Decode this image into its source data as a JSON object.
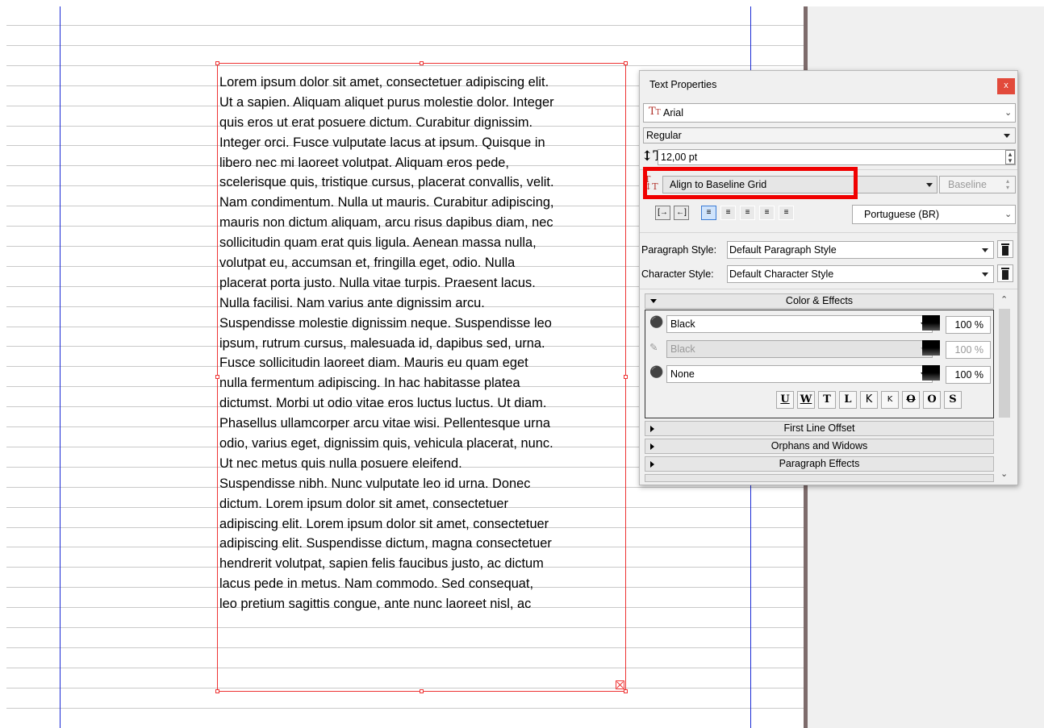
{
  "document": {
    "text_lines": [
      "Lorem ipsum dolor sit amet, consectetuer adipiscing elit.",
      "Ut a sapien. Aliquam aliquet purus molestie dolor. Integer",
      "quis eros ut erat posuere dictum. Curabitur dignissim.",
      "Integer orci. Fusce vulputate lacus at ipsum. Quisque in",
      "libero nec mi laoreet volutpat. Aliquam eros pede,",
      "scelerisque quis, tristique cursus, placerat convallis, velit.",
      "Nam condimentum. Nulla ut mauris. Curabitur adipiscing,",
      "mauris non dictum aliquam, arcu risus dapibus diam, nec",
      "sollicitudin quam erat quis ligula. Aenean massa nulla,",
      "volutpat eu, accumsan et, fringilla eget, odio. Nulla",
      "placerat porta justo. Nulla vitae turpis. Praesent lacus.",
      "Nulla facilisi. Nam varius ante dignissim arcu.",
      "Suspendisse molestie dignissim neque. Suspendisse leo",
      "ipsum, rutrum cursus, malesuada id, dapibus sed, urna.",
      "Fusce sollicitudin laoreet diam. Mauris eu quam eget",
      "nulla fermentum adipiscing. In hac habitasse platea",
      "dictumst. Morbi ut odio vitae eros luctus luctus. Ut diam.",
      "Phasellus ullamcorper arcu vitae wisi. Pellentesque urna",
      "odio, varius eget, dignissim quis, vehicula placerat, nunc.",
      "Ut nec metus quis nulla posuere eleifend.",
      "Suspendisse nibh. Nunc vulputate leo id urna. Donec",
      "dictum. Lorem ipsum dolor sit amet, consectetuer",
      "adipiscing elit. Lorem ipsum dolor sit amet, consectetuer",
      "adipiscing elit. Suspendisse dictum, magna consectetuer",
      "hendrerit volutpat, sapien felis faucibus justo, ac dictum",
      "lacus pede in metus. Nam commodo. Sed consequat,",
      "leo pretium sagittis congue, ante nunc laoreet nisl, ac"
    ]
  },
  "panel": {
    "title": "Text Properties",
    "close_glyph": "x",
    "font_family": "Arial",
    "font_style": "Regular",
    "font_size": "12,00 pt",
    "baseline_mode": "Align to Baseline Grid",
    "baseline_field": "Baseline",
    "language": "Portuguese (BR)",
    "paragraph_style_label": "Paragraph Style:",
    "paragraph_style": "Default Paragraph Style",
    "character_style_label": "Character Style:",
    "character_style": "Default Character Style",
    "sections": {
      "color_effects": "Color & Effects",
      "first_line_offset": "First Line Offset",
      "orphans_widows": "Orphans and Widows",
      "paragraph_effects": "Paragraph Effects"
    },
    "fill_color": "Black",
    "fill_shade": "100 %",
    "stroke_color": "Black",
    "stroke_shade": "100 %",
    "background_color": "None",
    "background_shade": "100 %",
    "effects": [
      "U",
      "W",
      "T",
      "L",
      "K",
      "K",
      "O",
      "O",
      "S"
    ]
  },
  "colors": {
    "highlight": "#f00000",
    "frame_border": "#e33333",
    "guide": "#1a2bd6",
    "close_button": "#e24a3b"
  }
}
